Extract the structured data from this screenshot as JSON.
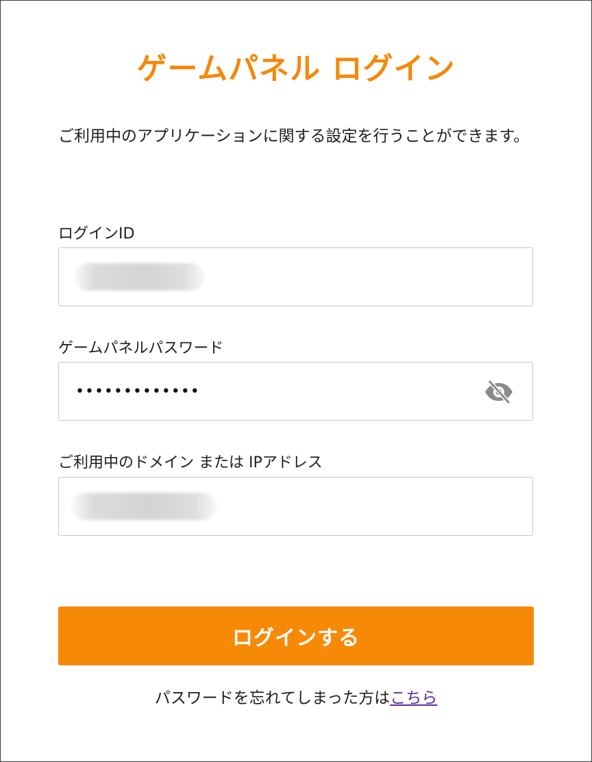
{
  "title": "ゲームパネル ログイン",
  "description": "ご利用中のアプリケーションに関する設定を行うことができます。",
  "fields": {
    "login_id": {
      "label": "ログインID",
      "value": "",
      "value_obscured": true
    },
    "password": {
      "label": "ゲームパネルパスワード",
      "masked_value": "•••••••••••••",
      "toggle_icon": "eye-slash-icon"
    },
    "domain": {
      "label": "ご利用中のドメイン または IPアドレス",
      "value": "",
      "value_obscured": true
    }
  },
  "login_button": {
    "label": "ログインする"
  },
  "forgot": {
    "text": "パスワードを忘れてしまった方は",
    "link_text": "こちら"
  },
  "colors": {
    "accent": "#f68a07",
    "link": "#5a2a9e",
    "input_border": "#c9c9c9",
    "icon": "#8a8a8a"
  }
}
